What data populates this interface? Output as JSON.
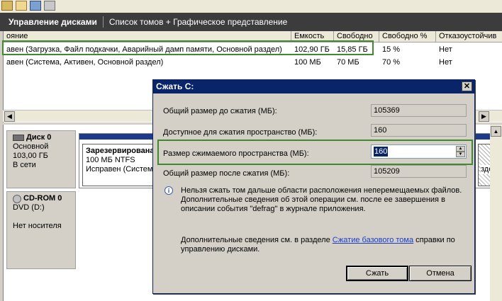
{
  "header": {
    "title": "Управление дисками",
    "subtitle": "Список томов + Графическое представление"
  },
  "volume_list": {
    "columns": [
      "Состояние",
      "Емкость",
      "Свободно",
      "Свободно %",
      "Отказоустойчивость"
    ],
    "columns_visible": [
      "ояние",
      "Емкость",
      "Свободно",
      "Свободно %",
      "Отказоустойчив"
    ],
    "rows": [
      {
        "status": "Исправен (Загрузка, Файл подкачки, Аварийный дамп памяти, Основной раздел)",
        "status_visible": "авен (Загрузка, Файл подкачки, Аварийный дамп памяти, Основной раздел)",
        "capacity": "102,90 ГБ",
        "free": "15,85 ГБ",
        "free_pct": "15 %",
        "fault": "Нет"
      },
      {
        "status": "Исправен (Система, Активен, Основной раздел)",
        "status_visible": "авен (Система, Активен, Основной раздел)",
        "capacity": "100 МБ",
        "free": "70 МБ",
        "free_pct": "70 %",
        "fault": "Нет"
      }
    ]
  },
  "disks": [
    {
      "name": "Диск 0",
      "type": "Основной",
      "size": "103,00 ГБ",
      "status": "В сети"
    },
    {
      "name": "CD-ROM 0",
      "type": "DVD (D:)",
      "size": "",
      "status": "Нет носителя"
    }
  ],
  "partitions": {
    "reserved": {
      "name": "Зарезервировано системой",
      "name_visible": "Зарезервирована",
      "fs": "100 МБ NTFS",
      "status": "Исправен (Система, Активен, Основной раздел)",
      "status_visible": "Исправен (Система,"
    },
    "second_visible": "здe"
  },
  "dialog": {
    "title": "Сжать С:",
    "total_before_label": "Общий размер до сжатия (МБ):",
    "total_before_value": "105369",
    "available_label": "Доступное для сжатия пространство (МБ):",
    "available_value": "160",
    "shrink_label": "Размер сжимаемого пространства (МБ):",
    "shrink_value": "160",
    "total_after_label": "Общий размер после сжатия (МБ):",
    "total_after_value": "105209",
    "info_text": "Нельзя сжать том дальше области расположения неперемещаемых файлов. Дополнительные сведения об этой операции см. после ее завершения в описании события \"defrag\" в журнале приложения.",
    "more_info_prefix": "Дополнительные сведения см. в разделе ",
    "more_info_link": "Сжатие базового тома",
    "more_info_suffix": " справки по управлению дисками.",
    "ok_button": "Сжать",
    "cancel_button": "Отмена"
  },
  "icons": [
    "folder-icon",
    "folder-open-icon",
    "search-icon",
    "tool-icon",
    "info-icon",
    "close-icon",
    "disk-icon",
    "cdrom-icon"
  ]
}
